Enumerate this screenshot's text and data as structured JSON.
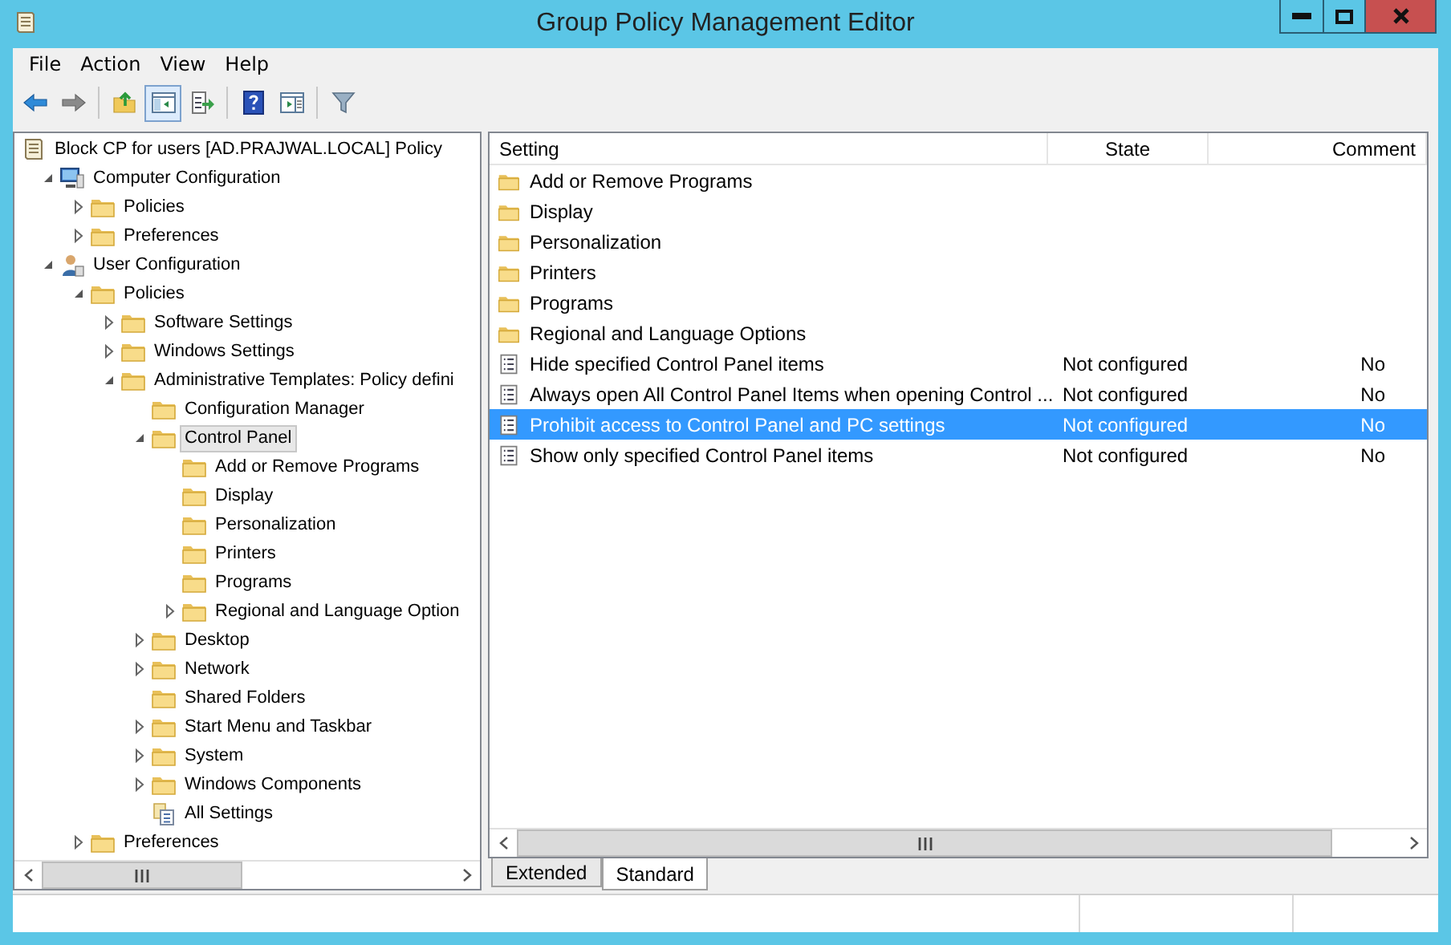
{
  "window": {
    "title": "Group Policy Management Editor"
  },
  "menu": [
    "File",
    "Action",
    "View",
    "Help"
  ],
  "toolbar": [
    {
      "kind": "back",
      "pressed": false
    },
    {
      "kind": "forward",
      "pressed": false
    },
    {
      "kind": "separator"
    },
    {
      "kind": "up",
      "pressed": false
    },
    {
      "kind": "tree",
      "pressed": true
    },
    {
      "kind": "export",
      "pressed": false
    },
    {
      "kind": "separator"
    },
    {
      "kind": "help",
      "pressed": false
    },
    {
      "kind": "panel",
      "pressed": false
    },
    {
      "kind": "separator"
    },
    {
      "kind": "filter",
      "pressed": false
    }
  ],
  "tree": [
    {
      "label": "Block CP for users [AD.PRAJWAL.LOCAL] Policy",
      "kind": "policy",
      "expandable": false,
      "selected": false,
      "children": [
        {
          "label": "Computer Configuration",
          "kind": "computer",
          "expandable": true,
          "expanded": true,
          "selected": false,
          "children": [
            {
              "label": "Policies",
              "kind": "folder",
              "expandable": true,
              "expanded": false,
              "selected": false
            },
            {
              "label": "Preferences",
              "kind": "folder",
              "expandable": true,
              "expanded": false,
              "selected": false
            }
          ]
        },
        {
          "label": "User Configuration",
          "kind": "user",
          "expandable": true,
          "expanded": true,
          "selected": false,
          "children": [
            {
              "label": "Policies",
              "kind": "folder",
              "expandable": true,
              "expanded": true,
              "selected": false,
              "children": [
                {
                  "label": "Software Settings",
                  "kind": "folder",
                  "expandable": true,
                  "expanded": false,
                  "selected": false
                },
                {
                  "label": "Windows Settings",
                  "kind": "folder",
                  "expandable": true,
                  "expanded": false,
                  "selected": false
                },
                {
                  "label": "Administrative Templates: Policy defini",
                  "kind": "folder",
                  "expandable": true,
                  "expanded": true,
                  "selected": false,
                  "children": [
                    {
                      "label": "Configuration Manager",
                      "kind": "folder",
                      "expandable": false,
                      "selected": false
                    },
                    {
                      "label": "Control Panel",
                      "kind": "folder",
                      "expandable": true,
                      "expanded": true,
                      "selected": true,
                      "children": [
                        {
                          "label": "Add or Remove Programs",
                          "kind": "folder",
                          "expandable": false,
                          "selected": false
                        },
                        {
                          "label": "Display",
                          "kind": "folder",
                          "expandable": false,
                          "selected": false
                        },
                        {
                          "label": "Personalization",
                          "kind": "folder",
                          "expandable": false,
                          "selected": false
                        },
                        {
                          "label": "Printers",
                          "kind": "folder",
                          "expandable": false,
                          "selected": false
                        },
                        {
                          "label": "Programs",
                          "kind": "folder",
                          "expandable": false,
                          "selected": false
                        },
                        {
                          "label": "Regional and Language Option",
                          "kind": "folder",
                          "expandable": true,
                          "expanded": false,
                          "selected": false
                        }
                      ]
                    },
                    {
                      "label": "Desktop",
                      "kind": "folder",
                      "expandable": true,
                      "expanded": false,
                      "selected": false
                    },
                    {
                      "label": "Network",
                      "kind": "folder",
                      "expandable": true,
                      "expanded": false,
                      "selected": false
                    },
                    {
                      "label": "Shared Folders",
                      "kind": "folder",
                      "expandable": false,
                      "selected": false
                    },
                    {
                      "label": "Start Menu and Taskbar",
                      "kind": "folder",
                      "expandable": true,
                      "expanded": false,
                      "selected": false
                    },
                    {
                      "label": "System",
                      "kind": "folder",
                      "expandable": true,
                      "expanded": false,
                      "selected": false
                    },
                    {
                      "label": "Windows Components",
                      "kind": "folder",
                      "expandable": true,
                      "expanded": false,
                      "selected": false
                    },
                    {
                      "label": "All Settings",
                      "kind": "allsettings",
                      "expandable": false,
                      "selected": false
                    }
                  ]
                }
              ]
            },
            {
              "label": "Preferences",
              "kind": "folder",
              "expandable": true,
              "expanded": false,
              "selected": false
            }
          ]
        }
      ]
    }
  ],
  "list": {
    "columns": [
      "Setting",
      "State",
      "Comment"
    ],
    "rows": [
      {
        "kind": "folder",
        "setting": "Add or Remove Programs",
        "selected": false
      },
      {
        "kind": "folder",
        "setting": "Display",
        "selected": false
      },
      {
        "kind": "folder",
        "setting": "Personalization",
        "selected": false
      },
      {
        "kind": "folder",
        "setting": "Printers",
        "selected": false
      },
      {
        "kind": "folder",
        "setting": "Programs",
        "selected": false
      },
      {
        "kind": "folder",
        "setting": "Regional and Language Options",
        "selected": false
      },
      {
        "kind": "setting",
        "setting": "Hide specified Control Panel items",
        "state": "Not configured",
        "comment": "No",
        "selected": false
      },
      {
        "kind": "setting",
        "setting": "Always open All Control Panel Items when opening Control ...",
        "state": "Not configured",
        "comment": "No",
        "selected": false
      },
      {
        "kind": "setting",
        "setting": "Prohibit access to Control Panel and PC settings",
        "state": "Not configured",
        "comment": "No",
        "selected": true
      },
      {
        "kind": "setting",
        "setting": "Show only specified Control Panel items",
        "state": "Not configured",
        "comment": "No",
        "selected": false
      }
    ]
  },
  "tabs": [
    {
      "label": "Extended",
      "selected": false
    },
    {
      "label": "Standard",
      "selected": true
    }
  ]
}
